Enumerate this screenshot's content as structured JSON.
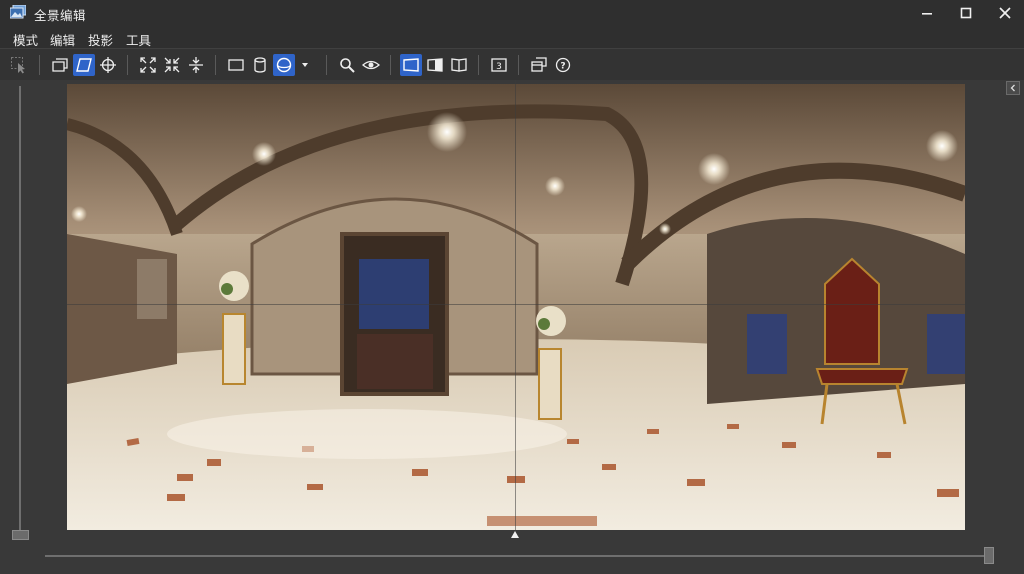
{
  "window": {
    "title": "全景编辑",
    "controls": [
      "minimize-icon",
      "maximize-icon",
      "close-icon"
    ]
  },
  "menu": {
    "items": [
      "模式",
      "编辑",
      "投影",
      "工具"
    ]
  },
  "toolbar": {
    "accent_color": "#2f64c9",
    "tools": [
      {
        "icon": "select-cursor-icon",
        "active": false,
        "enabled": false
      },
      {
        "icon": "layers-icon",
        "active": false
      },
      {
        "icon": "plane-icon",
        "active": true
      },
      {
        "icon": "crosshair-icon",
        "active": false
      },
      {
        "icon": "expand-icon",
        "active": false
      },
      {
        "icon": "contract-icon",
        "active": false
      },
      {
        "icon": "split-vertical-icon",
        "active": false
      },
      {
        "icon": "rectangle-projection-icon",
        "active": false
      },
      {
        "icon": "cylinder-projection-icon",
        "active": false
      },
      {
        "icon": "sphere-projection-icon",
        "active": true
      },
      {
        "icon": "dropdown-arrow-icon",
        "active": false
      },
      {
        "icon": "zoom-search-icon",
        "active": false
      },
      {
        "icon": "eye-preview-icon",
        "active": false
      },
      {
        "icon": "view-panel-single-icon",
        "active": true
      },
      {
        "icon": "view-panel-split-icon",
        "active": false
      },
      {
        "icon": "view-panel-book-icon",
        "active": false
      },
      {
        "icon": "number-3-icon",
        "label": "3",
        "active": false
      },
      {
        "icon": "window-copy-icon",
        "active": false
      },
      {
        "icon": "help-icon",
        "label": "?",
        "active": false
      }
    ]
  },
  "viewer": {
    "image_description_icon": "panorama-preview-icon",
    "vertical_slider_level": 0.0,
    "horizontal_slider_level": 1.0
  }
}
